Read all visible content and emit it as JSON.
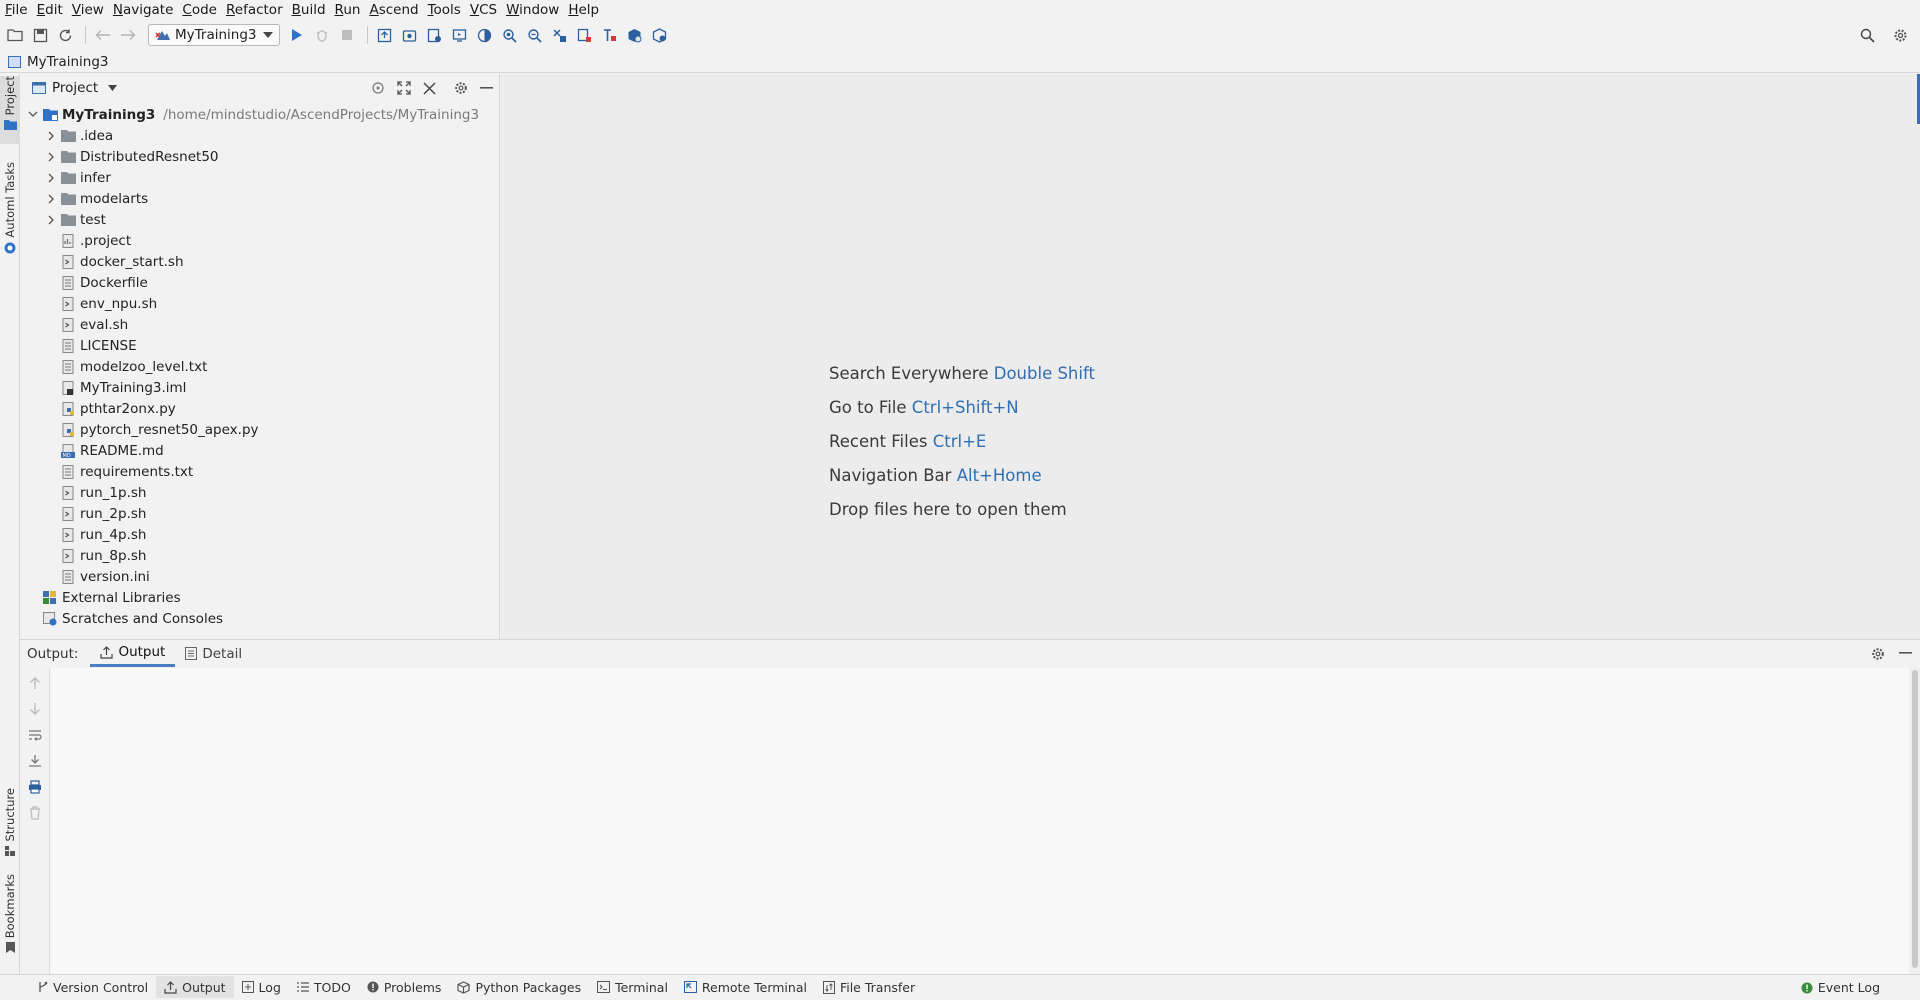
{
  "menu": [
    {
      "mn": "F",
      "rest": "ile"
    },
    {
      "mn": "E",
      "rest": "dit"
    },
    {
      "mn": "V",
      "rest": "iew"
    },
    {
      "mn": "N",
      "rest": "avigate"
    },
    {
      "mn": "C",
      "rest": "ode"
    },
    {
      "mn": "R",
      "rest": "efactor"
    },
    {
      "mn": "B",
      "rest": "uild"
    },
    {
      "mn": "R",
      "rest": "un"
    },
    {
      "mn": "A",
      "rest": "scend"
    },
    {
      "mn": "T",
      "rest": "ools"
    },
    {
      "mn": "V",
      "rest": "CS"
    },
    {
      "mn": "W",
      "rest": "indow"
    },
    {
      "mn": "H",
      "rest": "elp"
    }
  ],
  "toolbar": {
    "run_config": "MyTraining3"
  },
  "navbar": {
    "project": "MyTraining3"
  },
  "left_strip": {
    "project": "Project",
    "automl": "Automl Tasks",
    "structure": "Structure",
    "bookmarks": "Bookmarks"
  },
  "project_panel": {
    "title": "Project",
    "root": {
      "label": "MyTraining3",
      "path": "/home/mindstudio/AscendProjects/MyTraining3"
    },
    "folders": [
      ".idea",
      "DistributedResnet50",
      "infer",
      "modelarts",
      "test"
    ],
    "files": [
      ".project",
      "docker_start.sh",
      "Dockerfile",
      "env_npu.sh",
      "eval.sh",
      "LICENSE",
      "modelzoo_level.txt",
      "MyTraining3.iml",
      "pthtar2onx.py",
      "pytorch_resnet50_apex.py",
      "README.md",
      "requirements.txt",
      "run_1p.sh",
      "run_2p.sh",
      "run_4p.sh",
      "run_8p.sh",
      "version.ini"
    ],
    "external": "External Libraries",
    "scratches": "Scratches and Consoles"
  },
  "editor_hints": [
    {
      "text": "Search Everywhere",
      "shortcut": "Double Shift"
    },
    {
      "text": "Go to File",
      "shortcut": "Ctrl+Shift+N"
    },
    {
      "text": "Recent Files",
      "shortcut": "Ctrl+E"
    },
    {
      "text": "Navigation Bar",
      "shortcut": "Alt+Home"
    },
    {
      "text": "Drop files here to open them",
      "shortcut": ""
    }
  ],
  "output_panel": {
    "label": "Output:",
    "tabs": [
      "Output",
      "Detail"
    ]
  },
  "statusbar": {
    "items": [
      "Version Control",
      "Output",
      "Log",
      "TODO",
      "Problems",
      "Python Packages",
      "Terminal",
      "Remote Terminal",
      "File Transfer"
    ],
    "event_log": "Event Log"
  },
  "colors": {
    "accent": "#2f6fb2",
    "run_green": "#3c8a3c",
    "folder": "#8a9098"
  }
}
